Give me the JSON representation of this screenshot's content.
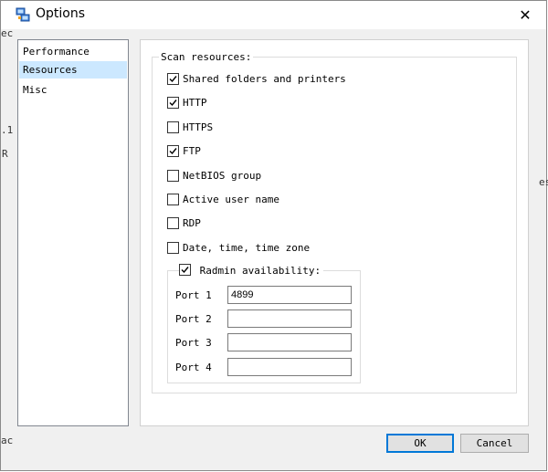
{
  "window": {
    "title": "Options",
    "close_glyph": "✕",
    "app_icon": "network-scanner-icon"
  },
  "background_fragments": [
    "ec",
    ".1",
    "R",
    "es",
    "ac"
  ],
  "nav": {
    "items": [
      {
        "label": "Performance",
        "selected": false
      },
      {
        "label": "Resources",
        "selected": true
      },
      {
        "label": "Misc",
        "selected": false
      }
    ]
  },
  "scan": {
    "group_label": "Scan resources:",
    "options": [
      {
        "label": "Shared folders and printers",
        "checked": true
      },
      {
        "label": "HTTP",
        "checked": true
      },
      {
        "label": "HTTPS",
        "checked": false
      },
      {
        "label": "FTP",
        "checked": true
      },
      {
        "label": "NetBIOS group",
        "checked": false
      },
      {
        "label": "Active user name",
        "checked": false
      },
      {
        "label": "RDP",
        "checked": false
      },
      {
        "label": "Date, time, time zone",
        "checked": false
      }
    ],
    "radmin": {
      "label": "Radmin availability:",
      "checked": true,
      "ports": [
        {
          "label": "Port 1",
          "value": "4899"
        },
        {
          "label": "Port 2",
          "value": ""
        },
        {
          "label": "Port 3",
          "value": ""
        },
        {
          "label": "Port 4",
          "value": ""
        }
      ]
    }
  },
  "buttons": {
    "ok": "OK",
    "cancel": "Cancel"
  },
  "colors": {
    "selection": "#cce8ff",
    "default_button_border": "#0078d7"
  }
}
